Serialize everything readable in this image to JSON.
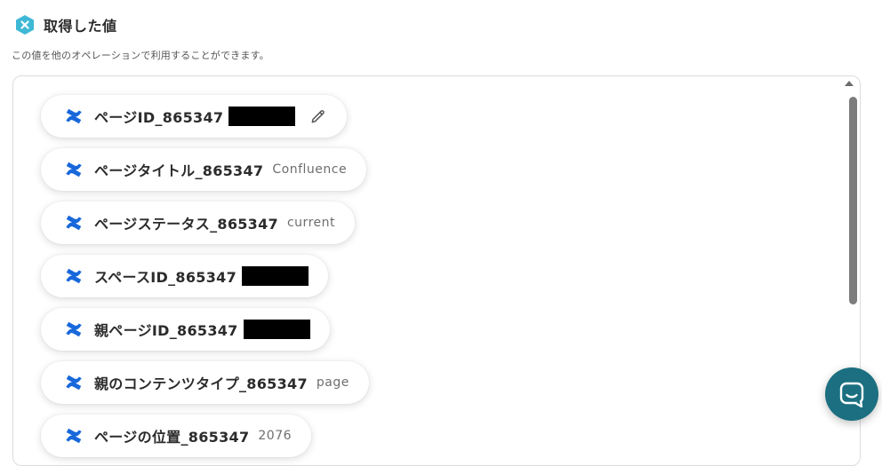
{
  "header": {
    "title": "取得した値",
    "logo_icon": "yoom-x-hexagon-icon"
  },
  "subtitle": "この値を他のオペレーションで利用することができます。",
  "colors": {
    "accent": "#3fb8d6",
    "confluence_blue": "#1868db",
    "chat_button": "#1b6f80"
  },
  "items": [
    {
      "label": "ページID_865347",
      "value": "",
      "redacted": true,
      "editable": true
    },
    {
      "label": "ページタイトル_865347",
      "value": "Confluence",
      "redacted": false,
      "editable": false
    },
    {
      "label": "ページステータス_865347",
      "value": "current",
      "redacted": false,
      "editable": false
    },
    {
      "label": "スペースID_865347",
      "value": "",
      "redacted": true,
      "editable": false
    },
    {
      "label": "親ページID_865347",
      "value": "",
      "redacted": true,
      "editable": false
    },
    {
      "label": "親のコンテンツタイプ_865347",
      "value": "page",
      "redacted": false,
      "editable": false
    },
    {
      "label": "ページの位置_865347",
      "value": "2076",
      "redacted": false,
      "editable": false
    }
  ],
  "chat_button": {
    "icon": "chat-bubble-icon"
  }
}
